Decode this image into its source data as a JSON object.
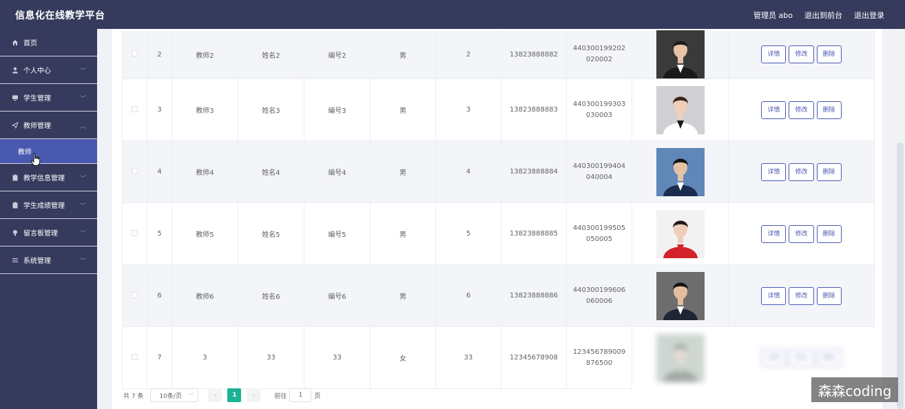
{
  "header": {
    "app_title": "信息化在线教学平台",
    "user_label": "管理员 abo",
    "back_label": "退出到前台",
    "logout_label": "退出登录"
  },
  "sidebar": {
    "items": [
      {
        "label": "首页",
        "icon": "home-icon"
      },
      {
        "label": "个人中心",
        "icon": "user-icon"
      },
      {
        "label": "学生管理",
        "icon": "monitor-icon"
      },
      {
        "label": "教师管理",
        "icon": "send-icon"
      },
      {
        "label": "教学信息管理",
        "icon": "clipboard-icon"
      },
      {
        "label": "学生成绩管理",
        "icon": "clipboard-icon"
      },
      {
        "label": "留言板管理",
        "icon": "bulb-icon"
      },
      {
        "label": "系统管理",
        "icon": "list-icon"
      }
    ],
    "active_sub": "教师"
  },
  "table": {
    "rows": [
      {
        "idx": "2",
        "account": "教师2",
        "name": "姓名2",
        "no": "编号2",
        "gender": "男",
        "age": "2",
        "phone": "13823888882",
        "id": "440300199202020002"
      },
      {
        "idx": "3",
        "account": "教师3",
        "name": "姓名3",
        "no": "编号3",
        "gender": "男",
        "age": "3",
        "phone": "13823888883",
        "id": "440300199303030003"
      },
      {
        "idx": "4",
        "account": "教师4",
        "name": "姓名4",
        "no": "编号4",
        "gender": "男",
        "age": "4",
        "phone": "13823888884",
        "id": "440300199404040004"
      },
      {
        "idx": "5",
        "account": "教师5",
        "name": "姓名5",
        "no": "编号5",
        "gender": "男",
        "age": "5",
        "phone": "13823888885",
        "id": "440300199505050005"
      },
      {
        "idx": "6",
        "account": "教师6",
        "name": "姓名6",
        "no": "编号6",
        "gender": "男",
        "age": "6",
        "phone": "13823888886",
        "id": "440300199606060006"
      },
      {
        "idx": "7",
        "account": "3",
        "name": "33",
        "no": "33",
        "gender": "女",
        "age": "33",
        "phone": "12345678908",
        "id": "123456789009876500"
      }
    ],
    "btn_detail": "详情",
    "btn_edit": "修改",
    "btn_delete": "删除"
  },
  "pager": {
    "total": "共 7 条",
    "size": "10条/页",
    "current": "1",
    "goto_label": "前往",
    "goto_value": "1",
    "page_suffix": "页"
  },
  "watermark": "森森coding",
  "colors": {
    "header_bg": "#363b5d",
    "active": "#4a59b0",
    "accent": "#1ab394"
  }
}
